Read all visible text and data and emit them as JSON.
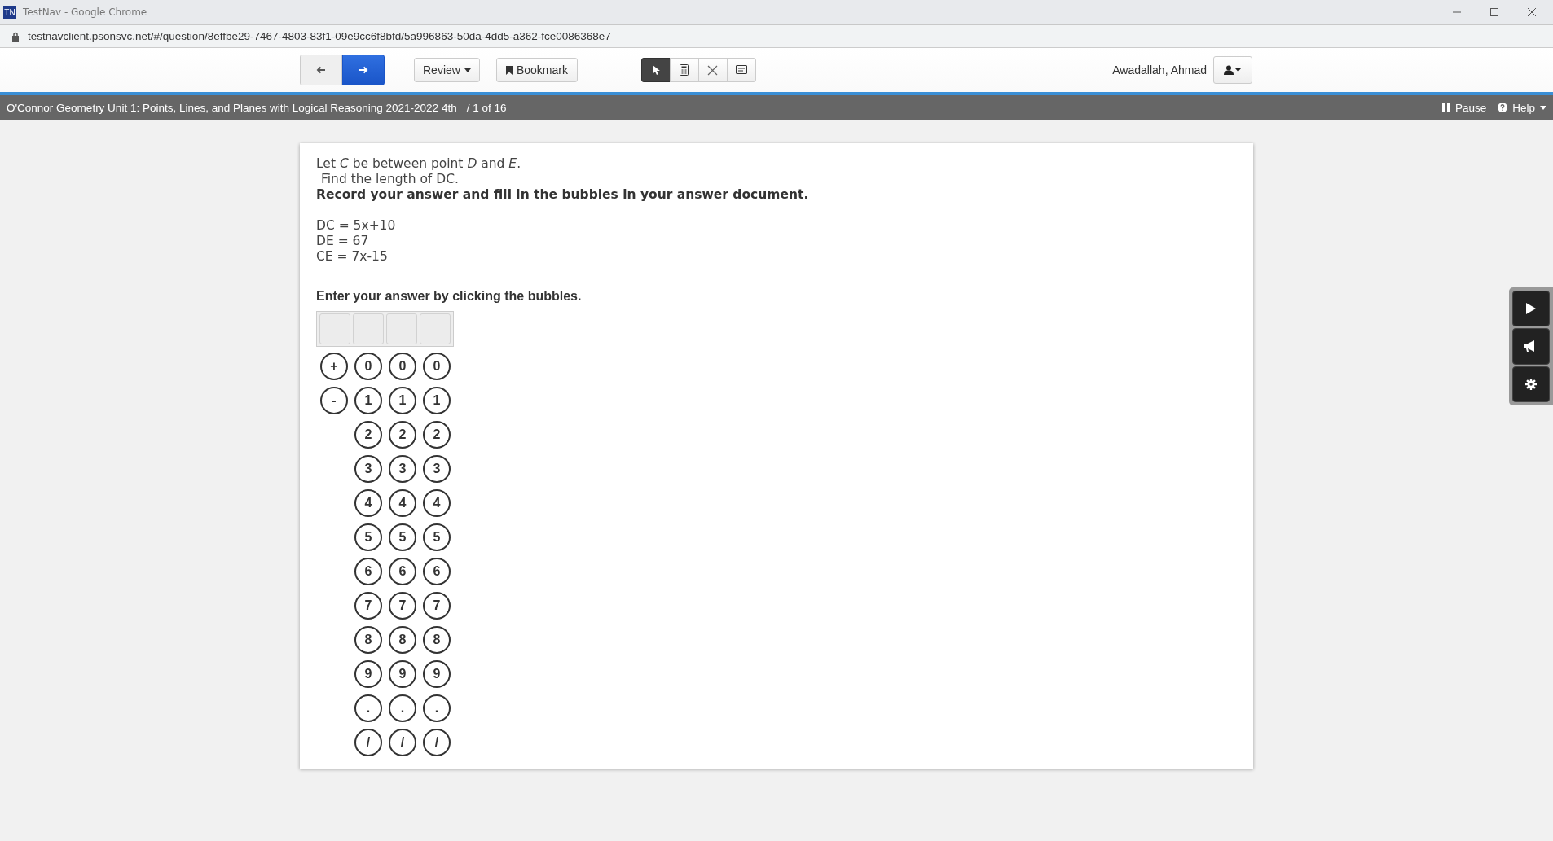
{
  "window": {
    "app_icon": "TN",
    "title": "TestNav - Google Chrome"
  },
  "address_bar": {
    "url": "testnavclient.psonsvc.net/#/question/8effbe29-7467-4803-83f1-09e9cc6f8bfd/5a996863-50da-4dd5-a362-fce0086368e7"
  },
  "toolbar": {
    "nav": [
      {
        "kind": "back",
        "selected": false
      },
      {
        "kind": "next",
        "selected": true
      }
    ],
    "review": "Review",
    "bookmark": "Bookmark",
    "tools": [
      {
        "kind": "pointer",
        "selected": true
      },
      {
        "kind": "calculator",
        "selected": false
      },
      {
        "kind": "eliminator",
        "selected": false
      },
      {
        "kind": "notes",
        "selected": false
      }
    ],
    "user_name": "Awadallah, Ahmad"
  },
  "test_bar": {
    "title": "O'Connor Geometry Unit 1: Points, Lines, and Planes with Logical Reasoning 2021-2022 4th",
    "progress": "/ 1 of 16",
    "pause": "Pause",
    "help": "Help"
  },
  "question": {
    "lines": [
      "Let *C* be between point *D* and *E*.",
      "Find the length of DC."
    ],
    "emphasis": "Record your answer and fill in the bubbles in your answer document.",
    "equations": [
      "DC = 5x+10",
      "DE = 67",
      "CE = 7x-15"
    ],
    "instruction": "Enter your answer by clicking the bubbles.",
    "columns": [
      {
        "bubbles": [
          "+",
          "-"
        ]
      },
      {
        "bubbles": [
          "0",
          "1",
          "2",
          "3",
          "4",
          "5",
          "6",
          "7",
          "8",
          "9",
          ".",
          "/"
        ]
      },
      {
        "bubbles": [
          "0",
          "1",
          "2",
          "3",
          "4",
          "5",
          "6",
          "7",
          "8",
          "9",
          ".",
          "/"
        ]
      },
      {
        "bubbles": [
          "0",
          "1",
          "2",
          "3",
          "4",
          "5",
          "6",
          "7",
          "8",
          "9",
          ".",
          "/"
        ]
      }
    ]
  },
  "side_tools": [
    {
      "kind": "play"
    },
    {
      "kind": "announce"
    },
    {
      "kind": "settings"
    }
  ]
}
